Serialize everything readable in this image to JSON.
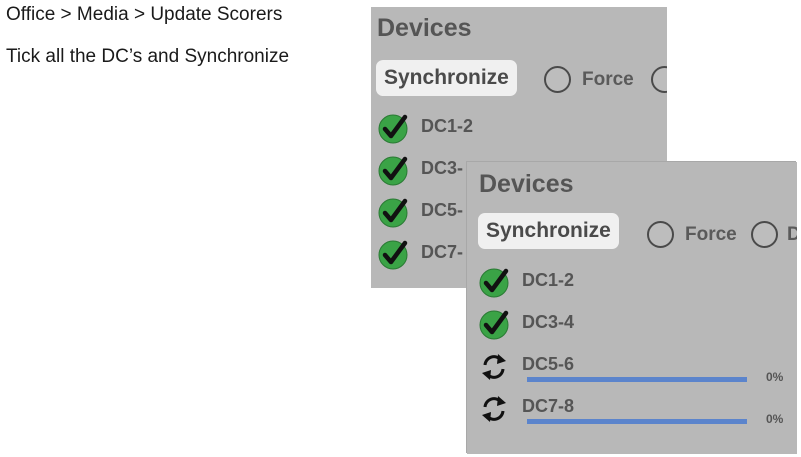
{
  "instructions": {
    "breadcrumb": "Office > Media > Update Scorers",
    "step": "Tick all the DC’s and Synchronize"
  },
  "back_panel": {
    "title": "Devices",
    "sync_label": "Synchronize",
    "force_label": "Force",
    "devices": [
      {
        "label": "DC1-2",
        "status": "checked"
      },
      {
        "label": "DC3-",
        "status": "checked"
      },
      {
        "label": "DC5-",
        "status": "checked"
      },
      {
        "label": "DC7-",
        "status": "checked"
      }
    ]
  },
  "front_panel": {
    "title": "Devices",
    "sync_label": "Synchronize",
    "force_label": "Force",
    "devices": [
      {
        "label": "DC1-2",
        "status": "checked"
      },
      {
        "label": "DC3-4",
        "status": "checked"
      },
      {
        "label": "DC5-6",
        "status": "syncing",
        "progress_text": "0%",
        "progress": 0
      },
      {
        "label": "DC7-8",
        "status": "syncing",
        "progress_text": "0%",
        "progress": 0
      }
    ]
  },
  "colors": {
    "check_green": "#3aa346",
    "progress_blue": "#5b84cc",
    "panel_bg": "#b8b8b8"
  }
}
